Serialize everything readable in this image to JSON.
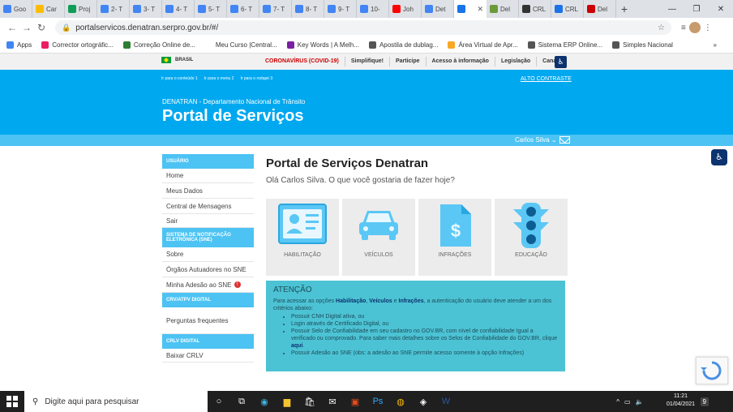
{
  "browser": {
    "tabs": [
      {
        "label": "Goo",
        "color": "#4285f4"
      },
      {
        "label": "Car",
        "color": "#fbbc05"
      },
      {
        "label": "Proj",
        "color": "#0f9d58"
      },
      {
        "label": "2- T",
        "color": "#4285f4"
      },
      {
        "label": "3- T",
        "color": "#4285f4"
      },
      {
        "label": "4- T",
        "color": "#4285f4"
      },
      {
        "label": "5- T",
        "color": "#4285f4"
      },
      {
        "label": "6- T",
        "color": "#4285f4"
      },
      {
        "label": "7- T",
        "color": "#4285f4"
      },
      {
        "label": "8- T",
        "color": "#4285f4"
      },
      {
        "label": "9- T",
        "color": "#4285f4"
      },
      {
        "label": "10-",
        "color": "#4285f4"
      },
      {
        "label": "Joh",
        "color": "#ff0000"
      },
      {
        "label": "Det",
        "color": "#4285f4"
      },
      {
        "label": "",
        "color": "#1a73e8"
      },
      {
        "label": "Del",
        "color": "#6a9a3a"
      },
      {
        "label": "CRL",
        "color": "#333333"
      },
      {
        "label": "CRL",
        "color": "#1a73e8"
      },
      {
        "label": "Del",
        "color": "#cc0000"
      }
    ],
    "new_tab": "+",
    "url": "portalservicos.denatran.serpro.gov.br/#/",
    "bookmarks": [
      {
        "label": "Apps",
        "color": "#4285f4"
      },
      {
        "label": "Corrector ortográfic...",
        "color": "#e91e63"
      },
      {
        "label": "Correção Online de...",
        "color": "#2e7d32"
      },
      {
        "label": "Meu Curso |Central...",
        "color": "#ffffff"
      },
      {
        "label": "Key Words | A Melh...",
        "color": "#7b1fa2"
      },
      {
        "label": "Apostila de dublag...",
        "color": "#555555"
      },
      {
        "label": "Área Virtual de Apr...",
        "color": "#f9a825"
      },
      {
        "label": "Sistema ERP Online...",
        "color": "#555555"
      },
      {
        "label": "Simples Nacional",
        "color": "#555555"
      }
    ],
    "more": "»"
  },
  "govbar": {
    "brasil": "BRASIL",
    "links": [
      "CORONAVÍRUS (COVID-19)",
      "Simplifique!",
      "Participe",
      "Acesso à informação",
      "Legislação",
      "Canais"
    ]
  },
  "header": {
    "skip_links": [
      "Ir para o conteúdo 1",
      "Ir para o menu 2",
      "Ir para o rodapé 3"
    ],
    "contrast": "ALTO CONTRASTE",
    "department": "DENATRAN - Departamento Nacional de Trânsito",
    "title": "Portal de Serviços"
  },
  "user": {
    "name": "Carlos Silva"
  },
  "sidebar": {
    "sections": [
      {
        "title": "USUÁRIO",
        "items": [
          {
            "label": "Home"
          },
          {
            "label": "Meus Dados"
          },
          {
            "label": "Central de Mensagens"
          },
          {
            "label": "Sair"
          }
        ]
      },
      {
        "title": "SISTEMA DE NOTIFICAÇÃO ELETRÔNICA (SNE)",
        "items": [
          {
            "label": "Sobre"
          },
          {
            "label": "Órgãos Autuadores no SNE"
          },
          {
            "label": "Minha Adesão ao SNE",
            "badge": "!"
          }
        ]
      },
      {
        "title": "CRV/ATPV DIGITAL",
        "items": [
          {
            "label": "Perguntas frequentes"
          }
        ]
      },
      {
        "title": "CRLV DIGITAL",
        "items": [
          {
            "label": "Baixar CRLV"
          }
        ]
      }
    ]
  },
  "main": {
    "title": "Portal de Serviços Denatran",
    "greeting": "Olá Carlos Silva. O que você gostaria de fazer hoje?",
    "cards": [
      {
        "label": "HABILITAÇÃO",
        "icon": "id-card-icon"
      },
      {
        "label": "VEÍCULOS",
        "icon": "car-icon"
      },
      {
        "label": "INFRAÇÕES",
        "icon": "document-dollar-icon"
      },
      {
        "label": "EDUCAÇÃO",
        "icon": "traffic-light-icon"
      }
    ],
    "attention": {
      "title": "ATENÇÃO",
      "intro_a": "Para acessar as opções ",
      "intro_b1": "Habilitação",
      "intro_sep1": ", ",
      "intro_b2": "Veículos",
      "intro_sep2": " e ",
      "intro_b3": "Infrações",
      "intro_c": ", a autenticação do usuário deve atender a um dos critérios abaixo:",
      "items": [
        "Possuir CNH Digital ativa, ou",
        "Login através de Certificado Digital, ou",
        "Possuir Selo de Confiabilidade em seu cadastro no GOV.BR, com nível de confiabilidade Igual a verificado ou comprovado. Para saber mais detalhes sobre os Selos de Confiabilidade do GOV.BR, clique",
        "Possuir Adesão ao SNE (obs: a adesão ao SNE permite acesso somente à opção Infrações)"
      ],
      "link": "aqui"
    }
  },
  "taskbar": {
    "search_placeholder": "Digite aqui para pesquisar",
    "time": "11:21",
    "date": "01/04/2021",
    "notif_count": "9"
  },
  "colors": {
    "brand_blue": "#00a8ef",
    "light_blue": "#4cc3f3",
    "navy": "#0c326f",
    "attention": "#4cc3d4"
  }
}
